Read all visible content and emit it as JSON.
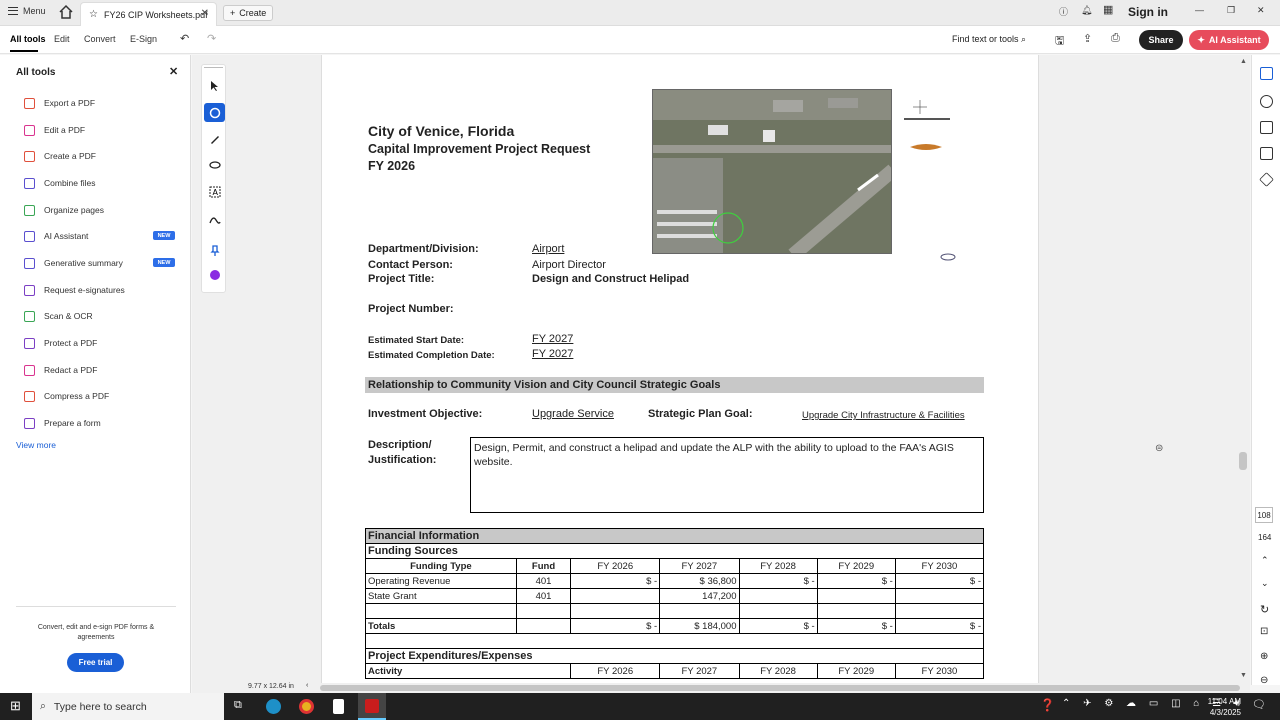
{
  "tabbar": {
    "menu": "Menu",
    "tab_title": "FY26 CIP Worksheets.pdf",
    "create": "Create",
    "sign_in": "Sign in"
  },
  "toolbar": {
    "all_tools": "All tools",
    "edit": "Edit",
    "convert": "Convert",
    "esign": "E-Sign",
    "find": "Find text or tools",
    "share": "Share",
    "ai_assistant": "AI Assistant"
  },
  "leftpanel": {
    "title": "All tools",
    "items": [
      {
        "label": "Export a PDF",
        "color": "#e0503c"
      },
      {
        "label": "Edit a PDF",
        "color": "#d9348f"
      },
      {
        "label": "Create a PDF",
        "color": "#e0503c"
      },
      {
        "label": "Combine files",
        "color": "#5a4fcf"
      },
      {
        "label": "Organize pages",
        "color": "#3aa655"
      },
      {
        "label": "AI Assistant",
        "color": "#5a4fcf",
        "badge": "NEW"
      },
      {
        "label": "Generative summary",
        "color": "#5a4fcf",
        "badge": "NEW"
      },
      {
        "label": "Request e-signatures",
        "color": "#7b3fc4"
      },
      {
        "label": "Scan & OCR",
        "color": "#3aa655"
      },
      {
        "label": "Protect a PDF",
        "color": "#7b3fc4"
      },
      {
        "label": "Redact a PDF",
        "color": "#d9348f"
      },
      {
        "label": "Compress a PDF",
        "color": "#e0503c"
      },
      {
        "label": "Prepare a form",
        "color": "#7b3fc4"
      }
    ],
    "view_more": "View more",
    "promo": "Convert, edit and e-sign PDF forms & agreements",
    "free_trial": "Free trial"
  },
  "doc": {
    "title1": "City of Venice, Florida",
    "title2": "Capital Improvement Project Request",
    "title3": "FY 2026",
    "dept_label": "Department/Division:",
    "dept_value": "Airport",
    "contact_label": "Contact Person:",
    "contact_value": "Airport Director",
    "ptitle_label": "Project Title:",
    "ptitle_value": "Design and Construct Helipad",
    "pnum_label": "Project Number:",
    "start_label": "Estimated Start Date:",
    "start_value": "FY 2027",
    "comp_label": "Estimated Completion Date:",
    "comp_value": "FY 2027",
    "section": "Relationship  to Community Vision and City Council Strategic Goals",
    "inv_label": "Investment Objective:",
    "inv_value": "Upgrade Service",
    "spg_label": "Strategic Plan Goal:",
    "spg_value": "Upgrade City Infrastructure & Facilities",
    "desc_label1": "Description/",
    "desc_label2": "Justification:",
    "desc_text": "Design, Permit, and construct a helipad and update the ALP with the ability to upload to the FAA's AGIS website.",
    "fin_header": "Financial Information",
    "funding_header": "Funding Sources",
    "cols": [
      "Funding Type",
      "Fund",
      "FY 2026",
      "FY 2027",
      "FY 2028",
      "FY 2029",
      "FY 2030"
    ],
    "rows": [
      {
        "type": "Operating Revenue",
        "fund": "401",
        "vals": [
          "$          -",
          "$        36,800",
          "$          -",
          "$          -",
          "$          -"
        ]
      },
      {
        "type": "State Grant",
        "fund": "401",
        "vals": [
          "",
          "147,200",
          "",
          "",
          ""
        ]
      }
    ],
    "totals_label": "Totals",
    "totals": [
      "$          -",
      "$      184,000",
      "$          -",
      "$          -",
      "$          -"
    ],
    "exp_header": "Project Expenditures/Expenses",
    "exp_cols": [
      "Activity",
      "FY 2026",
      "FY 2027",
      "FY 2028",
      "FY 2029",
      "FY 2030"
    ]
  },
  "rightrail": {
    "page": "108",
    "count": "164"
  },
  "status": {
    "dims": "9.77 x 12.64 in"
  },
  "taskbar": {
    "search": "Type here to search",
    "time": "11:04 AM",
    "date": "4/3/2025"
  }
}
